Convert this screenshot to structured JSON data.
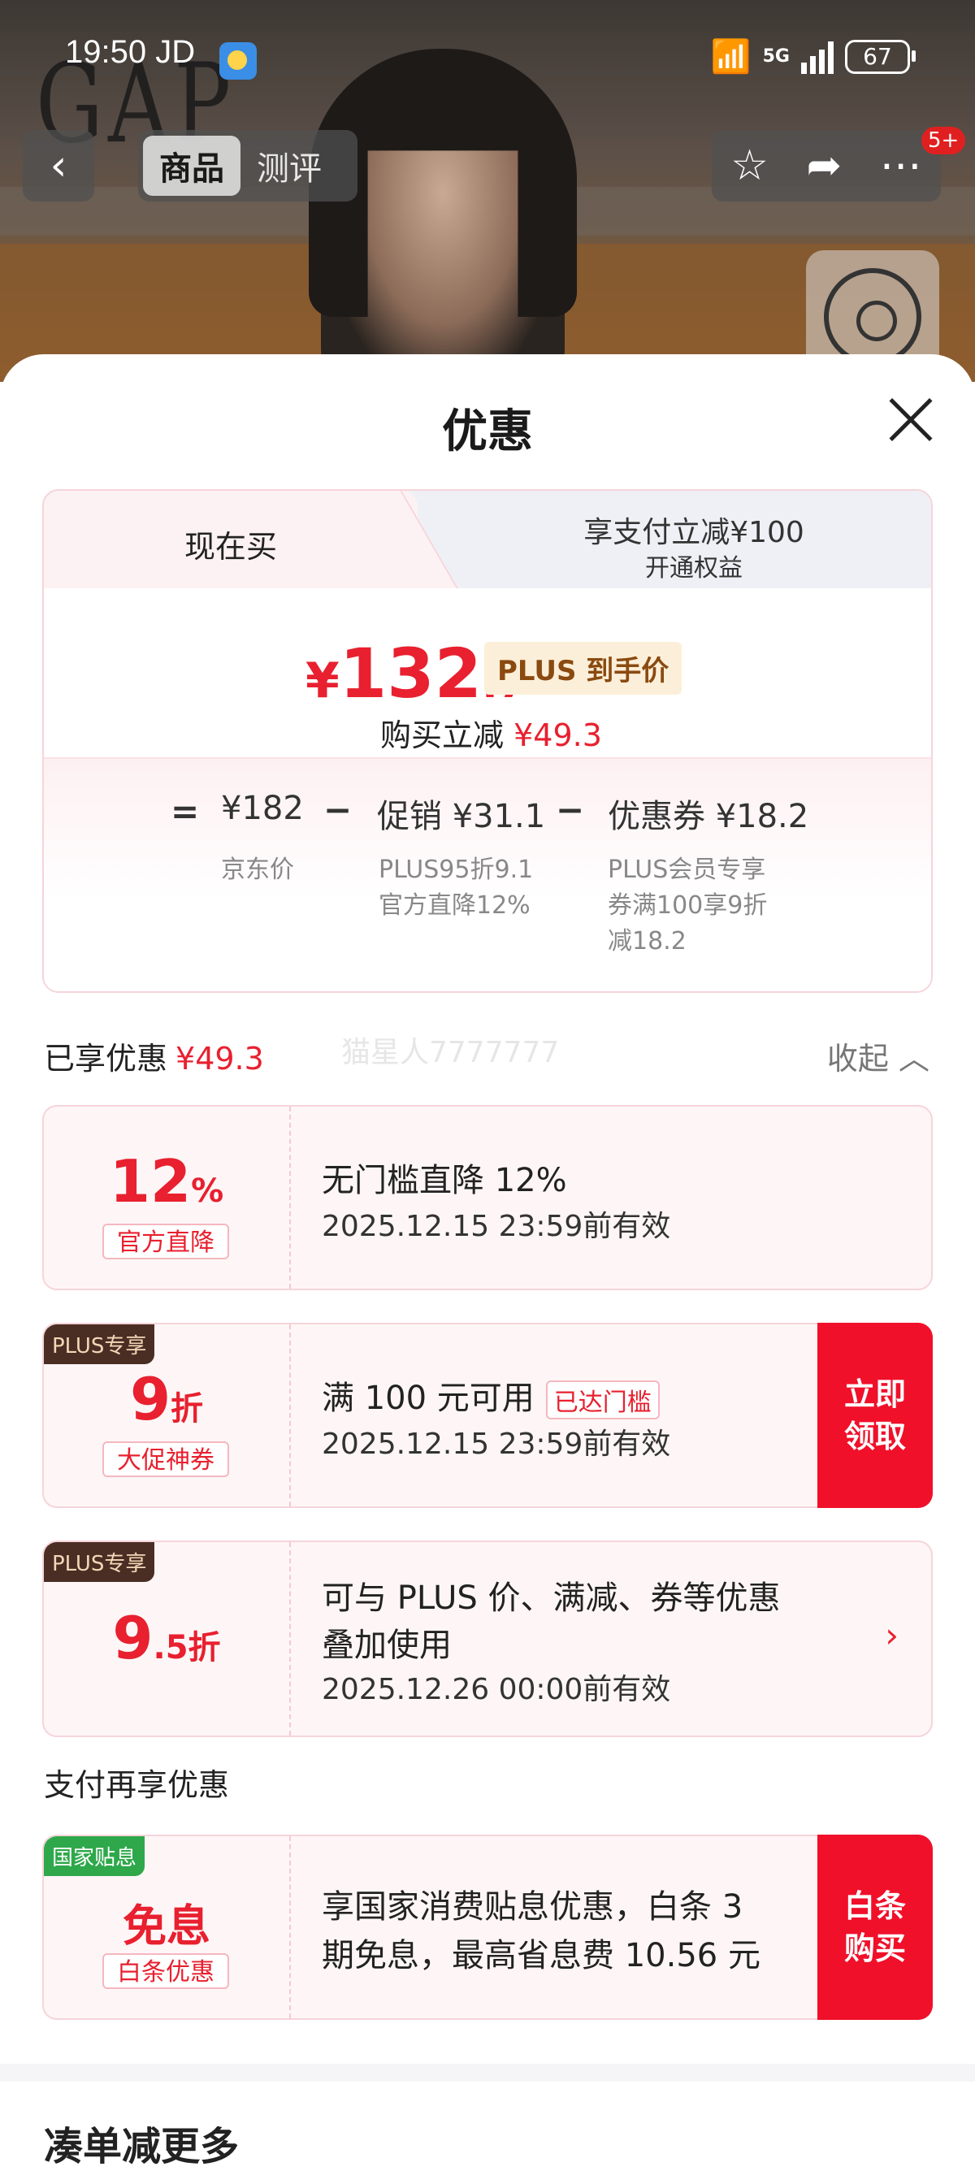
{
  "status": {
    "time": "19:50 JD",
    "network": "5G",
    "battery": "67"
  },
  "hero": {
    "logo_text": "GAP"
  },
  "nav": {
    "back_icon": "‹",
    "tabs": [
      "商品",
      "测评"
    ],
    "more_badge": "5+"
  },
  "sheet": {
    "title": "优惠",
    "price_card": {
      "tab_now": "现在买",
      "tab_pay_title": "享支付立减¥100",
      "tab_pay_sub": "开通权益",
      "currency": "¥",
      "price_int": "132",
      "price_dec": ".7",
      "plus_tag": "PLUS 到手价",
      "reduce_label": "购买立减",
      "reduce_value": "¥49.3",
      "eq": "=",
      "minus": "−",
      "jd_price": "¥182",
      "jd_price_note": "京东价",
      "promo": "促销 ¥31.1",
      "promo_note_1": "PLUS95折9.1",
      "promo_note_2": "官方直降12%",
      "coupon": "优惠券 ¥18.2",
      "coupon_note_1": "PLUS会员专享",
      "coupon_note_2": "券满100享9折",
      "coupon_note_3": "减18.2"
    },
    "enjoyed_label": "已享优惠",
    "enjoyed_value": "¥49.3",
    "watermark": "猫星人7777777",
    "collapse_label": "收起",
    "coupons": [
      {
        "big": "12",
        "big_suffix": "%",
        "tag": "官方直降",
        "title": "无门槛直降 12%",
        "date": "2025.12.15 23:59前有效"
      },
      {
        "badge": "PLUS专享",
        "big": "9",
        "big_suffix": "折",
        "tag": "大促神券",
        "title": "满 100 元可用",
        "reached": "已达门槛",
        "date": "2025.12.15 23:59前有效",
        "action": "立即\n领取"
      },
      {
        "badge": "PLUS专享",
        "big": "9",
        "big_suffix": ".5折",
        "title_1": "可与 PLUS 价、满减、券等优惠",
        "title_2": "叠加使用",
        "date": "2025.12.26 00:00前有效"
      }
    ],
    "pay_section_title": "支付再享优惠",
    "pay_coupon": {
      "badge": "国家贴息",
      "big": "免息",
      "tag": "白条优惠",
      "title_1": "享国家消费贴息优惠，白条 3",
      "title_2": "期免息，最高省息费 10.56 元",
      "action": "白条\n购买"
    },
    "more_section_title": "凑单减更多"
  },
  "colors": {
    "accent": "#e8202f",
    "action_red": "#f0102a",
    "plus_brown": "#4a2e24",
    "green": "#2ea84a"
  }
}
